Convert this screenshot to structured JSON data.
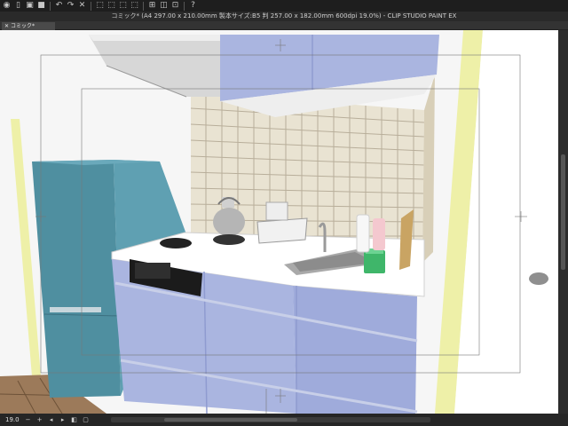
{
  "toolbar": {
    "buttons": [
      {
        "name": "navigator-icon",
        "glyph": "◉"
      },
      {
        "name": "new-file-icon",
        "glyph": "▯"
      },
      {
        "name": "open-file-icon",
        "glyph": "▣"
      },
      {
        "name": "save-icon",
        "glyph": "■"
      },
      {
        "name": "undo-icon",
        "glyph": "↶"
      },
      {
        "name": "redo-icon",
        "glyph": "↷"
      },
      {
        "name": "clear-icon",
        "glyph": "✕"
      },
      {
        "name": "selection-icon",
        "glyph": "⬚"
      },
      {
        "name": "deselect-icon",
        "glyph": "⬚"
      },
      {
        "name": "invert-icon",
        "glyph": "⬚"
      },
      {
        "name": "transform-icon",
        "glyph": "⬚"
      },
      {
        "name": "ruler-icon",
        "glyph": "⊞"
      },
      {
        "name": "snap-icon",
        "glyph": "◫"
      },
      {
        "name": "grid-icon",
        "glyph": "⊡"
      },
      {
        "name": "help-icon",
        "glyph": "?"
      }
    ]
  },
  "title": "コミック* (A4 297.00 x 210.00mm 製本サイズ:B5 判 257.00 x 182.00mm 600dpi 19.0%) - CLIP STUDIO PAINT EX",
  "tab": {
    "label": "コミック*"
  },
  "status": {
    "zoom": "19.0",
    "buttons": [
      {
        "name": "rotate-left-icon",
        "glyph": "◂"
      },
      {
        "name": "rotate-right-icon",
        "glyph": "▸"
      },
      {
        "name": "flip-icon",
        "glyph": "◧"
      },
      {
        "name": "fit-icon",
        "glyph": "▢"
      }
    ]
  },
  "colors": {
    "canvas_bg": "#f6f6f6",
    "cabinet": "#aab5e0",
    "cabinet_dark": "#8f9bd0",
    "fridge": "#4f8fa0",
    "tile": "#e9e3d2",
    "tile_grout": "#b8ae9a",
    "wall_yellow": "#eef0a8",
    "floor": "#9c7a5a"
  }
}
